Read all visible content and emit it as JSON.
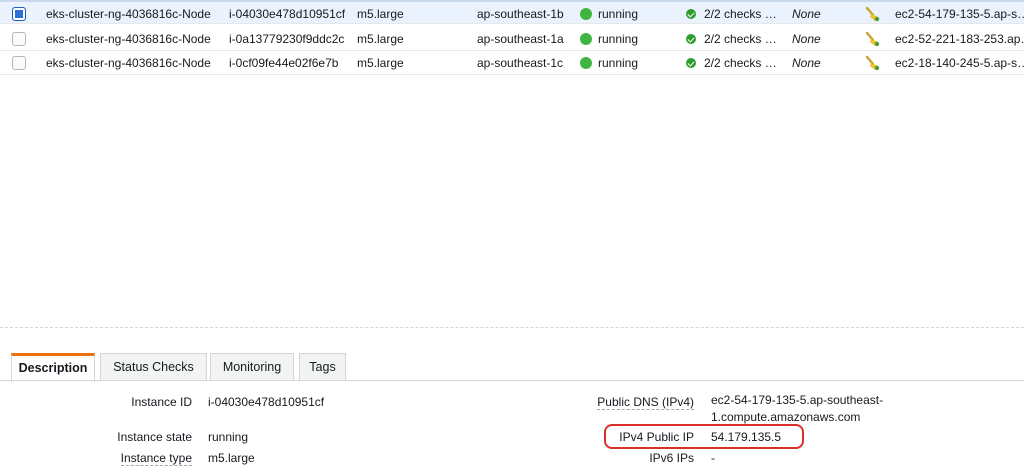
{
  "instances": [
    {
      "name": "eks-cluster-ng-4036816c-Node",
      "id": "i-04030e478d10951cf",
      "type": "m5.large",
      "az": "ap-southeast-1b",
      "state": "running",
      "checks": "2/2 checks …",
      "alarm": "None",
      "dns": "ec2-54-179-135-5.ap-s…",
      "selected": true
    },
    {
      "name": "eks-cluster-ng-4036816c-Node",
      "id": "i-0a13779230f9ddc2c",
      "type": "m5.large",
      "az": "ap-southeast-1a",
      "state": "running",
      "checks": "2/2 checks …",
      "alarm": "None",
      "dns": "ec2-52-221-183-253.ap…",
      "selected": false
    },
    {
      "name": "eks-cluster-ng-4036816c-Node",
      "id": "i-0cf09fe44e02f6e7b",
      "type": "m5.large",
      "az": "ap-southeast-1c",
      "state": "running",
      "checks": "2/2 checks …",
      "alarm": "None",
      "dns": "ec2-18-140-245-5.ap-s…",
      "selected": false
    }
  ],
  "tabs": [
    {
      "label": "Description",
      "active": true
    },
    {
      "label": "Status Checks",
      "active": false
    },
    {
      "label": "Monitoring",
      "active": false
    },
    {
      "label": "Tags",
      "active": false
    }
  ],
  "details": {
    "instance_id_label": "Instance ID",
    "instance_id_value": "i-04030e478d10951cf",
    "instance_state_label": "Instance state",
    "instance_state_value": "running",
    "instance_type_label": "Instance type",
    "instance_type_value": "m5.large",
    "public_dns_label": "Public DNS (IPv4)",
    "public_dns_value_line1": "ec2-54-179-135-5.ap-southeast-",
    "public_dns_value_line2": "1.compute.amazonaws.com",
    "ipv4_label": "IPv4 Public IP",
    "ipv4_value": "54.179.135.5",
    "ipv6_label": "IPv6 IPs",
    "ipv6_value": "-"
  },
  "colors": {
    "running": "#3fb53f",
    "selected_row": "#eaf3fd",
    "active_tab_accent": "#ec7211",
    "highlight": "#d9302c"
  },
  "icons": {
    "state": "running-dot-icon",
    "checks": "check-circle-icon",
    "monitoring": "monitoring-broom-icon"
  }
}
